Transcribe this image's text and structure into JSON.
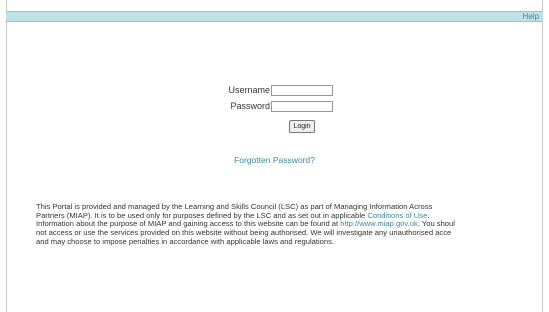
{
  "topbar": {
    "help_label": "Help"
  },
  "login": {
    "username_label": "Username",
    "password_label": "Password",
    "username_value": "",
    "password_value": "",
    "login_button": "Login",
    "forgot_password": "Forgotten Password?"
  },
  "disclaimer": {
    "line1": "This Portal is provided and managed by the Learning and Skills Council (LSC) as part of Managing Information Across",
    "line2_pre": "Partners (MIAP). It is to be used only for purposes defined by the LSC and as set out in applicable ",
    "line2_link": "Conditions of Use",
    "line2_post": ".",
    "line3_pre": "Information about the purpose of MIAP and gaining access to this website can be found at ",
    "line3_link": "http://www.miap.gov.uk",
    "line3_post": ". You shoul",
    "line4": "not access or use the services provided on this website without being authorised. We will investigate any unauthorised acce",
    "line5": "and may choose to impose penalties in accordance with applicable laws and regulations."
  },
  "colors": {
    "topbar_bg": "#bde3e9",
    "link": "#3a8aa4"
  }
}
